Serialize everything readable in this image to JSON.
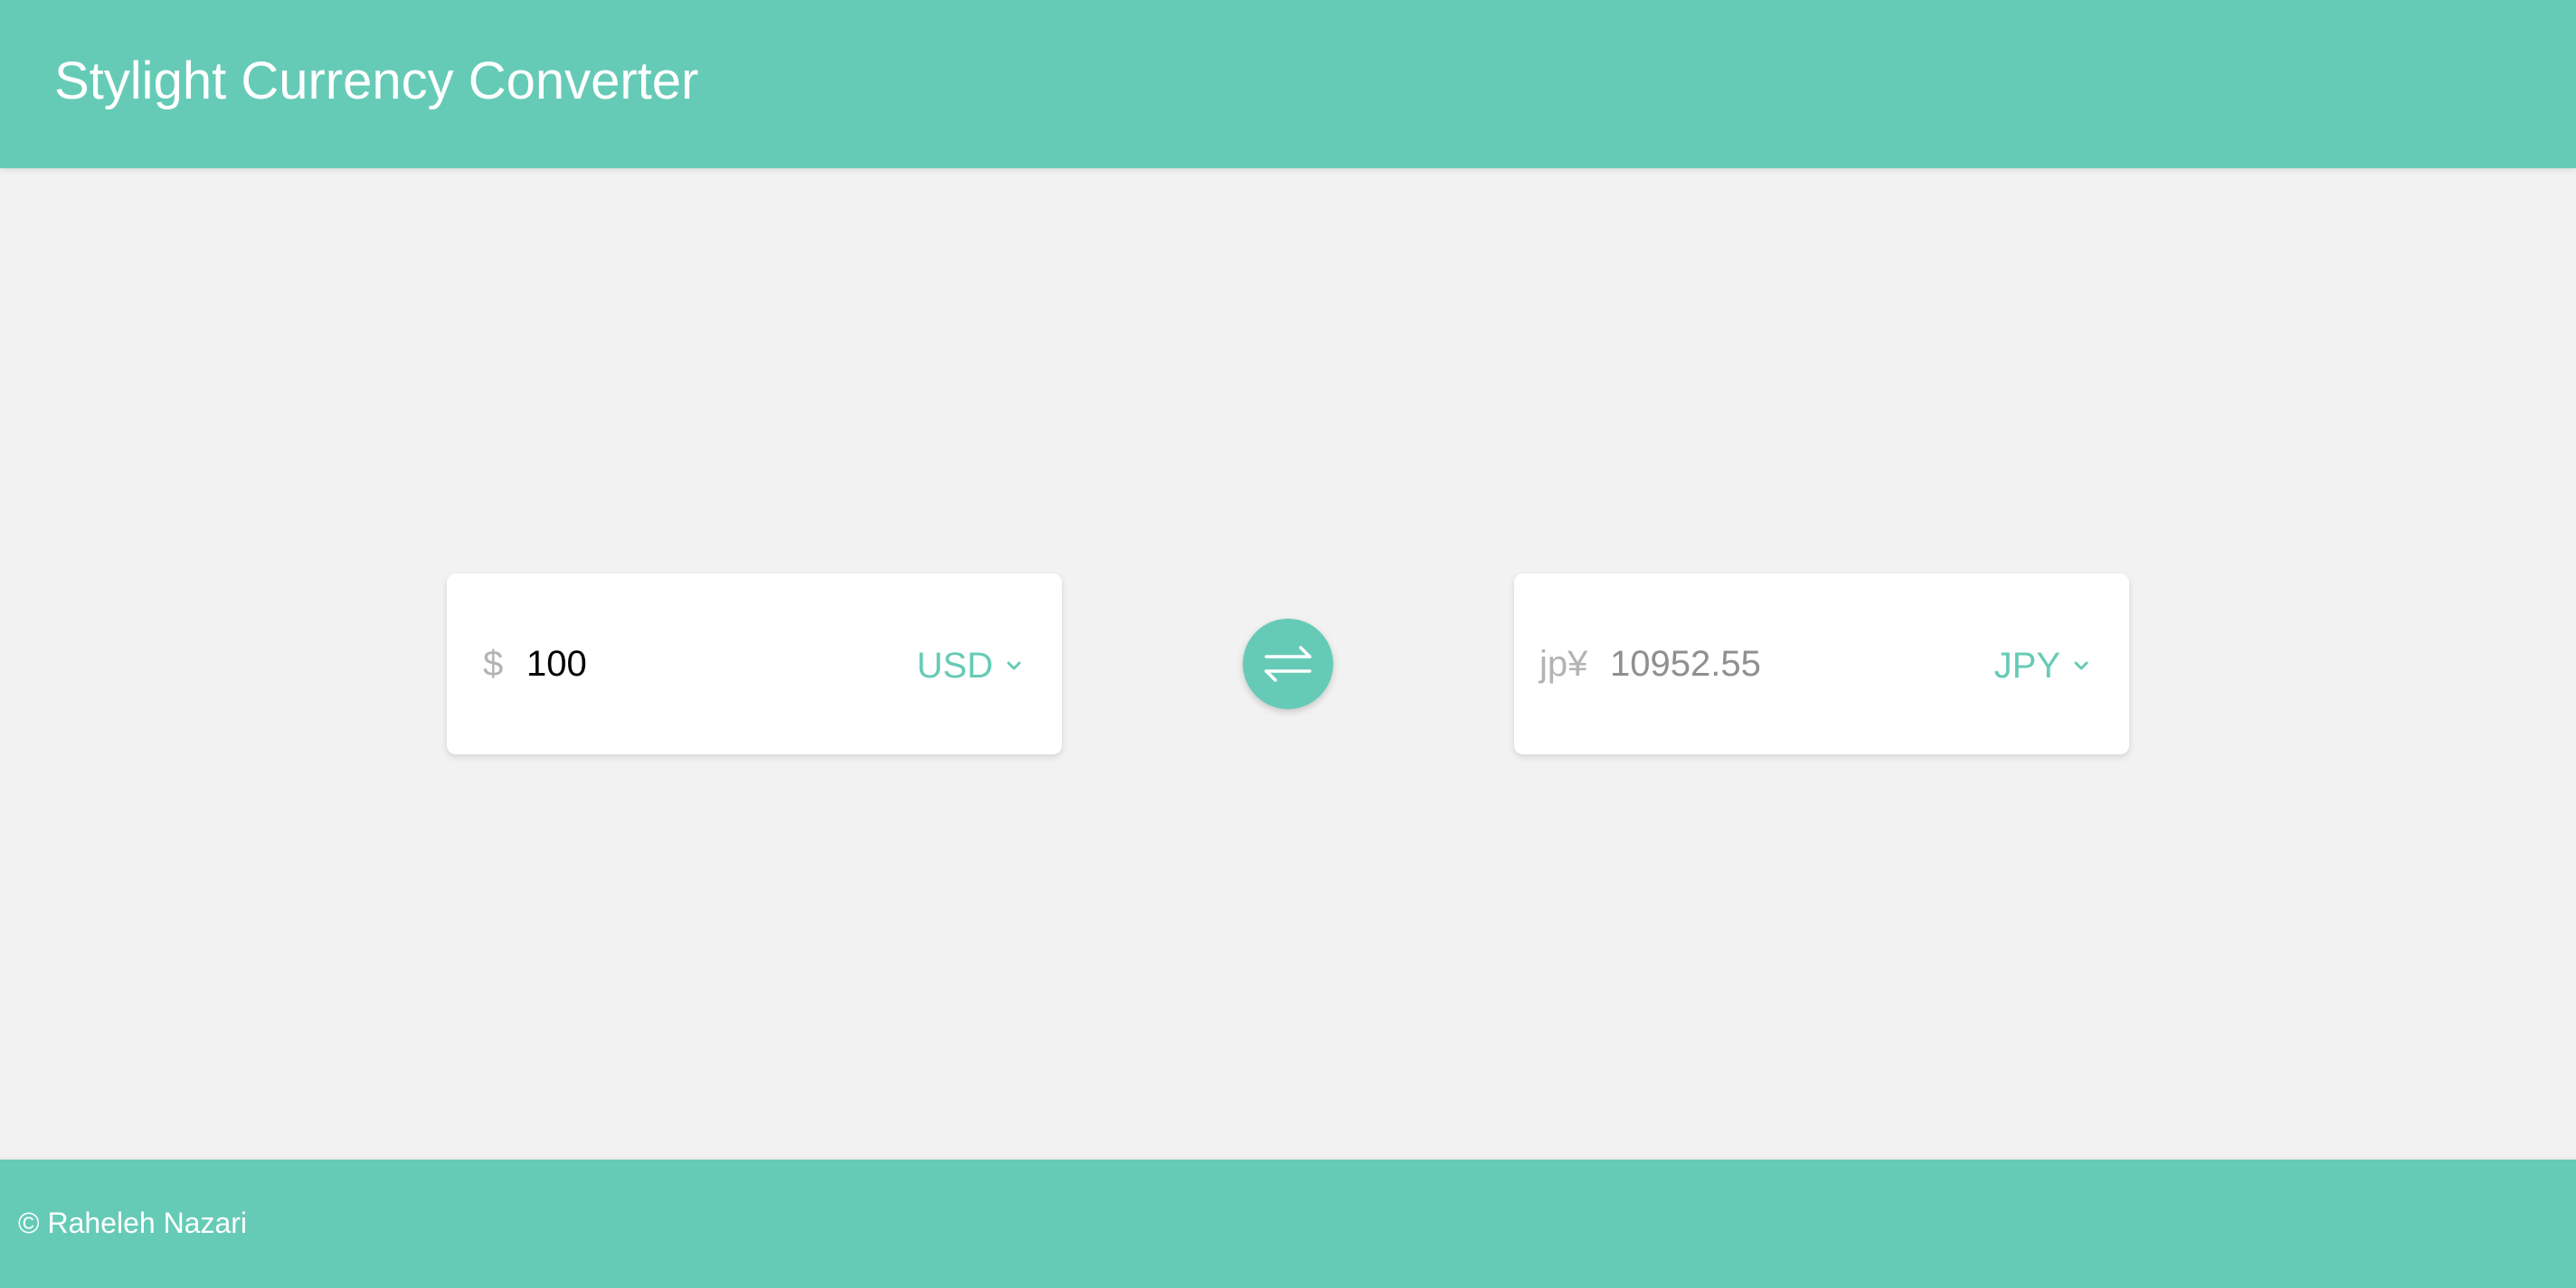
{
  "header": {
    "title": "Stylight Currency Converter"
  },
  "converter": {
    "from": {
      "symbol": "$",
      "amount": "100",
      "currency": "USD"
    },
    "to": {
      "symbol": "jp¥",
      "amount": "10952.55",
      "currency": "JPY"
    },
    "swap_icon": "swap-arrows-icon"
  },
  "footer": {
    "text": "© Raheleh Nazari"
  },
  "colors": {
    "accent": "#66cbb6",
    "background": "#f2f2f2",
    "card": "#ffffff",
    "muted_text": "#b3b3b3"
  }
}
